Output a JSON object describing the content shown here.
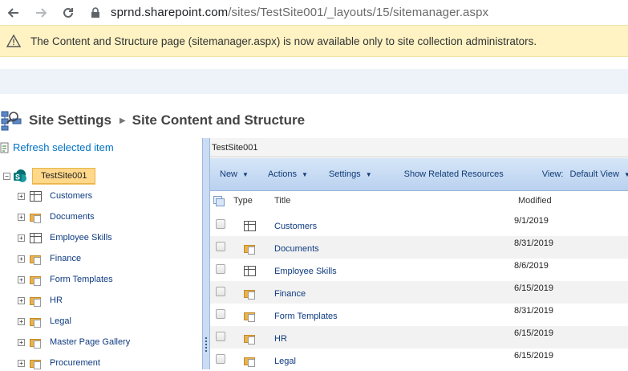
{
  "browser": {
    "url_host": "sprnd.sharepoint.com",
    "url_path": "/sites/TestSite001/_layouts/15/sitemanager.aspx"
  },
  "warning": {
    "text": "The Content and Structure page (sitemanager.aspx) is now available only to site collection administrators."
  },
  "page": {
    "breadcrumb_root": "Site Settings",
    "breadcrumb_current": "Site Content and Structure"
  },
  "tree": {
    "refresh_label": "Refresh selected item",
    "root": "TestSite001",
    "items": [
      {
        "label": "Customers",
        "icon": "list-icon"
      },
      {
        "label": "Documents",
        "icon": "library-icon"
      },
      {
        "label": "Employee Skills",
        "icon": "list-icon"
      },
      {
        "label": "Finance",
        "icon": "library-icon"
      },
      {
        "label": "Form Templates",
        "icon": "library-icon"
      },
      {
        "label": "HR",
        "icon": "library-icon"
      },
      {
        "label": "Legal",
        "icon": "library-icon"
      },
      {
        "label": "Master Page Gallery",
        "icon": "library-icon"
      },
      {
        "label": "Procurement",
        "icon": "library-icon"
      }
    ]
  },
  "content": {
    "crumb": "TestSite001",
    "toolbar": {
      "new": "New",
      "actions": "Actions",
      "settings": "Settings",
      "related": "Show Related Resources",
      "view_label": "View:",
      "view_value": "Default View"
    },
    "columns": {
      "type": "Type",
      "title": "Title",
      "modified": "Modified"
    },
    "rows": [
      {
        "title": "Customers",
        "modified": "9/1/2019",
        "icon": "list-icon"
      },
      {
        "title": "Documents",
        "modified": "8/31/2019",
        "icon": "library-icon"
      },
      {
        "title": "Employee Skills",
        "modified": "8/6/2019",
        "icon": "list-icon"
      },
      {
        "title": "Finance",
        "modified": "6/15/2019",
        "icon": "library-icon"
      },
      {
        "title": "Form Templates",
        "modified": "8/31/2019",
        "icon": "library-icon"
      },
      {
        "title": "HR",
        "modified": "6/15/2019",
        "icon": "library-icon"
      },
      {
        "title": "Legal",
        "modified": "6/15/2019",
        "icon": "library-icon"
      }
    ]
  },
  "colors": {
    "warning_bg": "#fff3c4",
    "link": "#0072c6",
    "toolbar": "#c8dcf4",
    "root_highlight": "#ffd88a"
  }
}
